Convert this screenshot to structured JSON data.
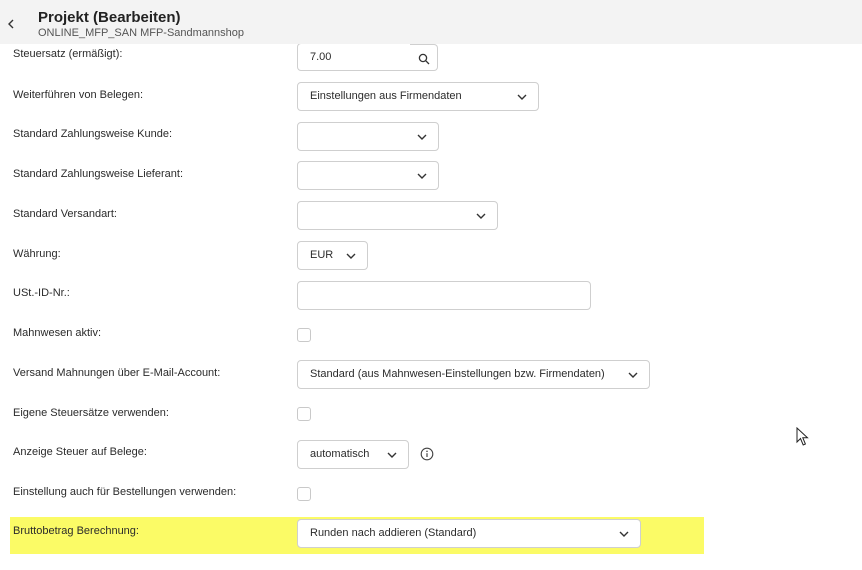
{
  "header": {
    "title": "Projekt (Bearbeiten)",
    "subtitle": "ONLINE_MFP_SAN MFP-Sandmannshop"
  },
  "fields": {
    "steuersatz": {
      "label": "Steuersatz (ermäßigt):",
      "value": "7.00"
    },
    "weiterfuehren": {
      "label": "Weiterführen von Belegen:",
      "value": "Einstellungen aus Firmendaten"
    },
    "zahlungsweise_kunde": {
      "label": "Standard Zahlungsweise Kunde:",
      "value": ""
    },
    "zahlungsweise_lieferant": {
      "label": "Standard Zahlungsweise Lieferant:",
      "value": ""
    },
    "versandart": {
      "label": "Standard Versandart:",
      "value": ""
    },
    "waehrung": {
      "label": "Währung:",
      "value": "EUR"
    },
    "ust_id": {
      "label": "USt.-ID-Nr.:",
      "value": ""
    },
    "mahnwesen": {
      "label": "Mahnwesen aktiv:",
      "checked": false
    },
    "versand_mahnungen": {
      "label": "Versand Mahnungen über E-Mail-Account:",
      "value": "Standard (aus Mahnwesen-Einstellungen bzw. Firmendaten)"
    },
    "eigene_steuersaetze": {
      "label": "Eigene Steuersätze verwenden:",
      "checked": false
    },
    "anzeige_steuer": {
      "label": "Anzeige Steuer auf Belege:",
      "value": "automatisch"
    },
    "einstellung_bestellungen": {
      "label": "Einstellung auch für Bestellungen verwenden:",
      "checked": false
    },
    "bruttobetrag": {
      "label": "Bruttobetrag Berechnung:",
      "value": "Runden nach addieren (Standard)"
    }
  },
  "colors": {
    "highlight": "#fbfb66",
    "header_bg": "#f3f3f3",
    "border": "#cfcfcf"
  },
  "icons": {
    "back": "chevron-left-icon",
    "search": "search-icon",
    "dropdown": "chevron-down-icon",
    "info": "info-icon",
    "cursor": "mouse-cursor-icon"
  }
}
